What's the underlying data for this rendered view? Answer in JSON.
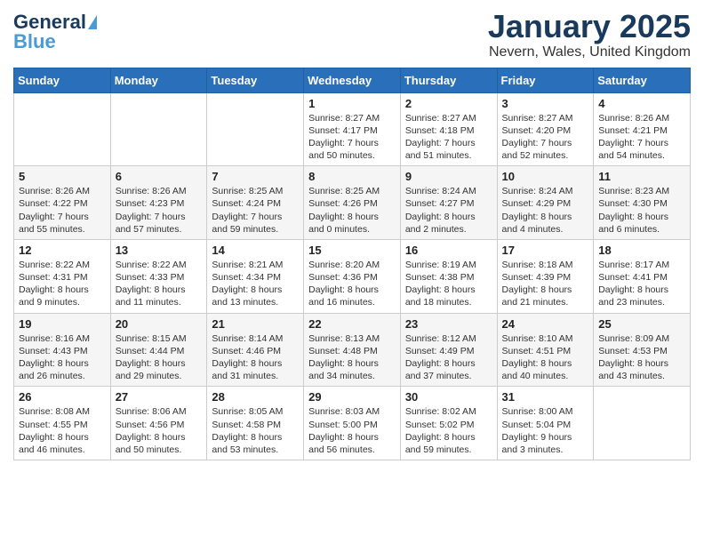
{
  "header": {
    "logo": {
      "general": "General",
      "blue": "Blue"
    },
    "title": "January 2025",
    "subtitle": "Nevern, Wales, United Kingdom"
  },
  "weekdays": [
    "Sunday",
    "Monday",
    "Tuesday",
    "Wednesday",
    "Thursday",
    "Friday",
    "Saturday"
  ],
  "weeks": [
    [
      {
        "day": "",
        "info": ""
      },
      {
        "day": "",
        "info": ""
      },
      {
        "day": "",
        "info": ""
      },
      {
        "day": "1",
        "info": "Sunrise: 8:27 AM\nSunset: 4:17 PM\nDaylight: 7 hours\nand 50 minutes."
      },
      {
        "day": "2",
        "info": "Sunrise: 8:27 AM\nSunset: 4:18 PM\nDaylight: 7 hours\nand 51 minutes."
      },
      {
        "day": "3",
        "info": "Sunrise: 8:27 AM\nSunset: 4:20 PM\nDaylight: 7 hours\nand 52 minutes."
      },
      {
        "day": "4",
        "info": "Sunrise: 8:26 AM\nSunset: 4:21 PM\nDaylight: 7 hours\nand 54 minutes."
      }
    ],
    [
      {
        "day": "5",
        "info": "Sunrise: 8:26 AM\nSunset: 4:22 PM\nDaylight: 7 hours\nand 55 minutes."
      },
      {
        "day": "6",
        "info": "Sunrise: 8:26 AM\nSunset: 4:23 PM\nDaylight: 7 hours\nand 57 minutes."
      },
      {
        "day": "7",
        "info": "Sunrise: 8:25 AM\nSunset: 4:24 PM\nDaylight: 7 hours\nand 59 minutes."
      },
      {
        "day": "8",
        "info": "Sunrise: 8:25 AM\nSunset: 4:26 PM\nDaylight: 8 hours\nand 0 minutes."
      },
      {
        "day": "9",
        "info": "Sunrise: 8:24 AM\nSunset: 4:27 PM\nDaylight: 8 hours\nand 2 minutes."
      },
      {
        "day": "10",
        "info": "Sunrise: 8:24 AM\nSunset: 4:29 PM\nDaylight: 8 hours\nand 4 minutes."
      },
      {
        "day": "11",
        "info": "Sunrise: 8:23 AM\nSunset: 4:30 PM\nDaylight: 8 hours\nand 6 minutes."
      }
    ],
    [
      {
        "day": "12",
        "info": "Sunrise: 8:22 AM\nSunset: 4:31 PM\nDaylight: 8 hours\nand 9 minutes."
      },
      {
        "day": "13",
        "info": "Sunrise: 8:22 AM\nSunset: 4:33 PM\nDaylight: 8 hours\nand 11 minutes."
      },
      {
        "day": "14",
        "info": "Sunrise: 8:21 AM\nSunset: 4:34 PM\nDaylight: 8 hours\nand 13 minutes."
      },
      {
        "day": "15",
        "info": "Sunrise: 8:20 AM\nSunset: 4:36 PM\nDaylight: 8 hours\nand 16 minutes."
      },
      {
        "day": "16",
        "info": "Sunrise: 8:19 AM\nSunset: 4:38 PM\nDaylight: 8 hours\nand 18 minutes."
      },
      {
        "day": "17",
        "info": "Sunrise: 8:18 AM\nSunset: 4:39 PM\nDaylight: 8 hours\nand 21 minutes."
      },
      {
        "day": "18",
        "info": "Sunrise: 8:17 AM\nSunset: 4:41 PM\nDaylight: 8 hours\nand 23 minutes."
      }
    ],
    [
      {
        "day": "19",
        "info": "Sunrise: 8:16 AM\nSunset: 4:43 PM\nDaylight: 8 hours\nand 26 minutes."
      },
      {
        "day": "20",
        "info": "Sunrise: 8:15 AM\nSunset: 4:44 PM\nDaylight: 8 hours\nand 29 minutes."
      },
      {
        "day": "21",
        "info": "Sunrise: 8:14 AM\nSunset: 4:46 PM\nDaylight: 8 hours\nand 31 minutes."
      },
      {
        "day": "22",
        "info": "Sunrise: 8:13 AM\nSunset: 4:48 PM\nDaylight: 8 hours\nand 34 minutes."
      },
      {
        "day": "23",
        "info": "Sunrise: 8:12 AM\nSunset: 4:49 PM\nDaylight: 8 hours\nand 37 minutes."
      },
      {
        "day": "24",
        "info": "Sunrise: 8:10 AM\nSunset: 4:51 PM\nDaylight: 8 hours\nand 40 minutes."
      },
      {
        "day": "25",
        "info": "Sunrise: 8:09 AM\nSunset: 4:53 PM\nDaylight: 8 hours\nand 43 minutes."
      }
    ],
    [
      {
        "day": "26",
        "info": "Sunrise: 8:08 AM\nSunset: 4:55 PM\nDaylight: 8 hours\nand 46 minutes."
      },
      {
        "day": "27",
        "info": "Sunrise: 8:06 AM\nSunset: 4:56 PM\nDaylight: 8 hours\nand 50 minutes."
      },
      {
        "day": "28",
        "info": "Sunrise: 8:05 AM\nSunset: 4:58 PM\nDaylight: 8 hours\nand 53 minutes."
      },
      {
        "day": "29",
        "info": "Sunrise: 8:03 AM\nSunset: 5:00 PM\nDaylight: 8 hours\nand 56 minutes."
      },
      {
        "day": "30",
        "info": "Sunrise: 8:02 AM\nSunset: 5:02 PM\nDaylight: 8 hours\nand 59 minutes."
      },
      {
        "day": "31",
        "info": "Sunrise: 8:00 AM\nSunset: 5:04 PM\nDaylight: 9 hours\nand 3 minutes."
      },
      {
        "day": "",
        "info": ""
      }
    ]
  ]
}
